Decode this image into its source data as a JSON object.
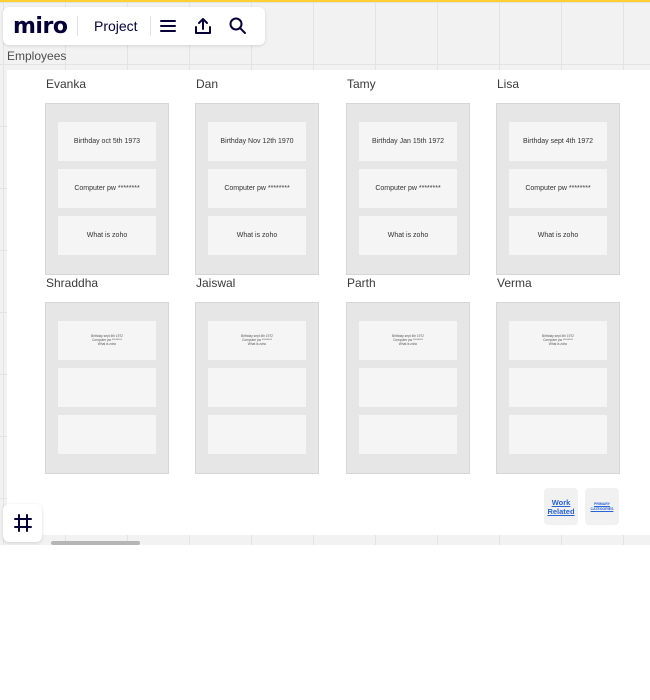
{
  "app": {
    "logo": "miro",
    "project_name": "Project",
    "accent_color": "#ffd02f",
    "icons": [
      "menu-icon",
      "upload-icon",
      "search-icon",
      "frames-icon"
    ]
  },
  "board": {
    "frame_title": "Employees",
    "cards": [
      {
        "name": "Evanka",
        "notes": [
          "Birthday oct 5th 1973",
          "Computer pw ********",
          "What is zoho"
        ]
      },
      {
        "name": "Dan",
        "notes": [
          "Birthday Nov 12th 1970",
          "Computer pw ********",
          "What is zoho"
        ]
      },
      {
        "name": "Tamy",
        "notes": [
          "Birthday Jan 15th 1972",
          "Computer pw ********",
          "What is zoho"
        ]
      },
      {
        "name": "Lisa",
        "notes": [
          "Birthday sept 4th 1972",
          "Computer pw ********",
          "What is zoho"
        ]
      },
      {
        "name": "Shraddha",
        "notes": [
          "Birthday sept 4th 1972\nComputer pw ********\nWhat is zoho",
          "",
          ""
        ]
      },
      {
        "name": "Jaiswal",
        "notes": [
          "Birthday sept 4th 1972\nComputer pw ********\nWhat is zoho",
          "",
          ""
        ]
      },
      {
        "name": "Parth",
        "notes": [
          "Birthday sept 4th 1972\nComputer pw ********\nWhat is zoho",
          "",
          ""
        ]
      },
      {
        "name": "Verma",
        "notes": [
          "Birthday sept 4th 1972\nComputer pw ********\nWhat is zoho",
          "",
          ""
        ]
      }
    ],
    "stickies": {
      "work": "Work Related",
      "primary": "PRIMARY CATEGORIES"
    }
  }
}
